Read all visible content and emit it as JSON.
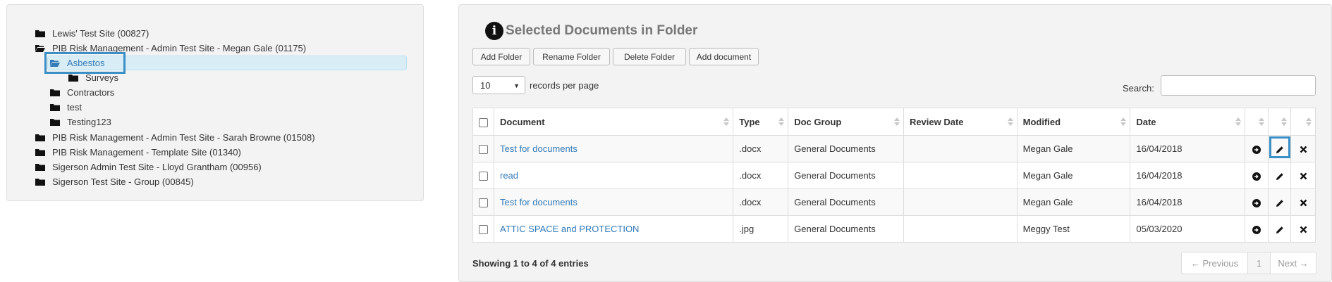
{
  "tree": {
    "items": [
      {
        "label": "Lewis' Test Site (00827)",
        "state": "closed"
      },
      {
        "label": "PIB Risk Management - Admin Test Site - Megan Gale (01175)",
        "state": "open"
      },
      {
        "label": "Asbestos",
        "state": "open",
        "selected": true
      },
      {
        "label": "Surveys",
        "state": "closed"
      },
      {
        "label": "Contractors",
        "state": "closed"
      },
      {
        "label": "test",
        "state": "closed"
      },
      {
        "label": "Testing123",
        "state": "closed"
      },
      {
        "label": "PIB Risk Management - Admin Test Site - Sarah Browne (01508)",
        "state": "closed"
      },
      {
        "label": "PIB Risk Management - Template Site (01340)",
        "state": "closed"
      },
      {
        "label": "Sigerson Admin Test Site - Lloyd Grantham (00956)",
        "state": "closed"
      },
      {
        "label": "Sigerson Test Site - Group (00845)",
        "state": "closed"
      }
    ]
  },
  "panel": {
    "title": "Selected Documents in Folder",
    "info_icon": "i"
  },
  "toolbar": {
    "add_folder": "Add Folder",
    "rename_folder": "Rename Folder",
    "delete_folder": "Delete Folder",
    "add_document": "Add document"
  },
  "length": {
    "value": "10",
    "suffix": "records per page"
  },
  "search": {
    "label": "Search:",
    "value": ""
  },
  "table": {
    "columns": [
      "Document",
      "Type",
      "Doc Group",
      "Review Date",
      "Modified",
      "Date"
    ],
    "rows": [
      {
        "document": "Test for documents",
        "type": ".docx",
        "group": "General Documents",
        "review": "",
        "modified": "Megan Gale",
        "date": "16/04/2018"
      },
      {
        "document": "read",
        "type": ".docx",
        "group": "General Documents",
        "review": "",
        "modified": "Megan Gale",
        "date": "16/04/2018"
      },
      {
        "document": "Test for documents",
        "type": ".docx",
        "group": "General Documents",
        "review": "",
        "modified": "Megan Gale",
        "date": "16/04/2018"
      },
      {
        "document": "ATTIC SPACE and PROTECTION",
        "type": ".jpg",
        "group": "General Documents",
        "review": "",
        "modified": "Meggy Test",
        "date": "05/03/2020"
      }
    ]
  },
  "footer": {
    "info": "Showing 1 to 4 of 4 entries",
    "prev": "← Previous",
    "page": "1",
    "next": "Next →"
  },
  "colors": {
    "link": "#337ab7",
    "highlight": "#3a8fc6",
    "selected_bg": "#d9edf7"
  }
}
